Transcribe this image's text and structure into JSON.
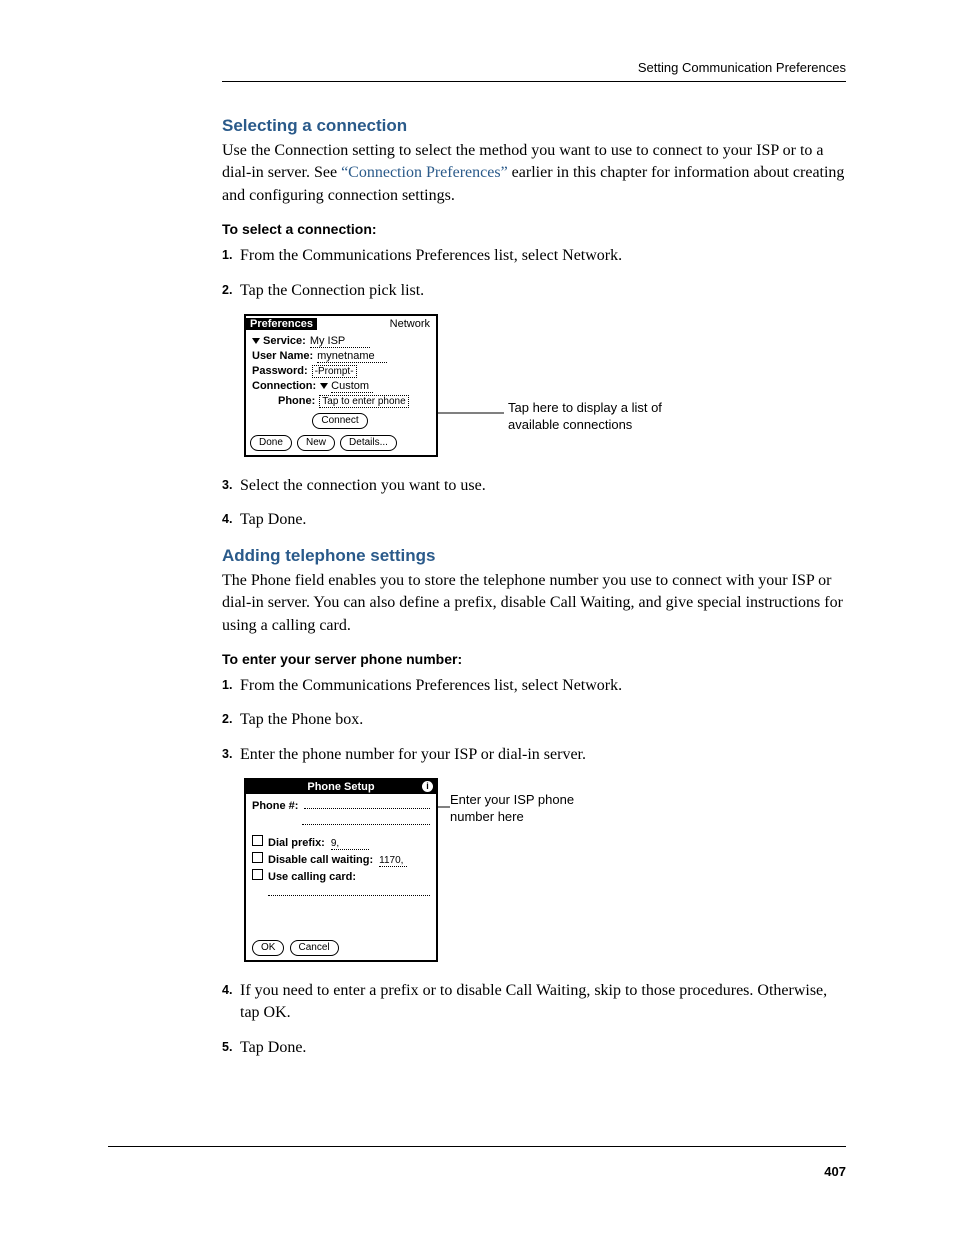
{
  "header": {
    "running": "Setting Communication Preferences"
  },
  "sec1": {
    "title": "Selecting a connection",
    "intro_a": "Use the Connection setting to select the method you want to use to connect to your ISP or to a dial-in server. See ",
    "intro_link": "“Connection Preferences”",
    "intro_b": " earlier in this chapter for information about creating and configuring connection settings.",
    "proc_title": "To select a connection:",
    "steps": {
      "s1": "From the Communications Preferences list, select Network.",
      "s2": "Tap the Connection pick list.",
      "s3": "Select the connection you want to use.",
      "s4": "Tap Done."
    },
    "callout": "Tap here to display a list of available connections"
  },
  "palm1": {
    "title_left": "Preferences",
    "title_right": "Network",
    "service_lbl": "Service:",
    "service_val": "My ISP",
    "user_lbl": "User Name:",
    "user_val": "mynetname",
    "pass_lbl": "Password:",
    "pass_val": "-Prompt-",
    "conn_lbl": "Connection:",
    "conn_val": "Custom",
    "phone_lbl": "Phone:",
    "phone_val": "Tap to enter phone",
    "connect_btn": "Connect",
    "done_btn": "Done",
    "new_btn": "New",
    "details_btn": "Details..."
  },
  "sec2": {
    "title": "Adding telephone settings",
    "intro": "The Phone field enables you to store the telephone number you use to connect with your ISP or dial-in server. You can also define a prefix, disable Call Waiting, and give special instructions for using a calling card.",
    "proc_title": "To enter your server phone number:",
    "steps": {
      "s1": "From the Communications Preferences list, select Network.",
      "s2": "Tap the Phone box.",
      "s3": "Enter the phone number for your ISP or dial-in server.",
      "s4": "If you need to enter a prefix or to disable Call Waiting, skip to those procedures. Otherwise, tap OK.",
      "s5": "Tap Done."
    },
    "callout": "Enter your ISP phone number here"
  },
  "palm2": {
    "title": "Phone Setup",
    "info_icon": "i",
    "phone_lbl": "Phone #:",
    "prefix_lbl": "Dial prefix:",
    "prefix_val": "9,",
    "dcw_lbl": "Disable call waiting:",
    "dcw_val": "1170,",
    "card_lbl": "Use calling card:",
    "ok_btn": "OK",
    "cancel_btn": "Cancel"
  },
  "page_number": "407"
}
